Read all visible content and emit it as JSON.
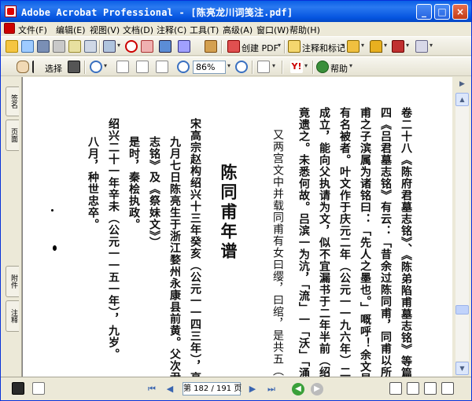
{
  "window": {
    "title": "Adobe Acrobat Professional - [陈亮龙川词笺注.pdf]",
    "buttons": {
      "minimize": "_",
      "maximize": "□",
      "close": "×"
    }
  },
  "menu": [
    "文件(F)",
    "编辑(E)",
    "视图(V)",
    "文档(D)",
    "注释(C)",
    "工具(T)",
    "高级(A)",
    "窗口(W)",
    "帮助(H)"
  ],
  "toolbar1": {
    "create_pdf": "创建 PDF",
    "comment_mark": "注释和标记"
  },
  "toolbar2": {
    "select": "选择",
    "zoom_value": "86%",
    "help": "帮助"
  },
  "side_tabs": [
    "签名",
    "页面",
    "附件",
    "注释"
  ],
  "page_nav": {
    "current": "第 182",
    "total": "/ 191 页"
  },
  "document_columns": [
    {
      "text": "卷二十八《陈府君墓志铭》、《陈弟陷甫墓志铭》等篇，",
      "style": "bold"
    },
    {
      "text": "四《吕君墓志铭》有云：「昔余过陈同甫，同甫以所述夏氏",
      "style": "bold"
    },
    {
      "text": "甫之子滨属为诸铭曰：「先人之墨也。」嘅呼！余文显陋",
      "style": "bold"
    },
    {
      "text": "有名被者。叶文作于庆元二年（公元一一九六年）二月，",
      "style": "bold"
    },
    {
      "text": "成立，能向父执请为文，似不宜漏书于二年半前（绍熙四",
      "style": "bold"
    },
    {
      "text": "竟遗之。未悉何故。吕滨一为沆，「流」一「沃」「涌」等字",
      "style": "bold"
    },
    {
      "text": "又两宫文中并载同甫有女曰缨，曰绾，是共五（六）口",
      "style": "normal"
    },
    {
      "text": "陈同甫年谱",
      "style": "head"
    },
    {
      "text": "宋高宗赵构绍兴十三年癸亥（公元一一四三年），亮一岁",
      "style": "bold"
    },
    {
      "text": "九月七日陈亮生于浙江婺州永康县前黄。父次尹，母",
      "style": "bold"
    },
    {
      "text": "志铭》及《祭妹文》）",
      "style": "bold"
    },
    {
      "text": "是时，秦桧执政。",
      "style": "bold"
    },
    {
      "text": "绍兴二十一年辛未（公元一一五一年），九岁。",
      "style": "bold"
    },
    {
      "text": "八月，种世忠卒。",
      "style": "bold"
    }
  ]
}
